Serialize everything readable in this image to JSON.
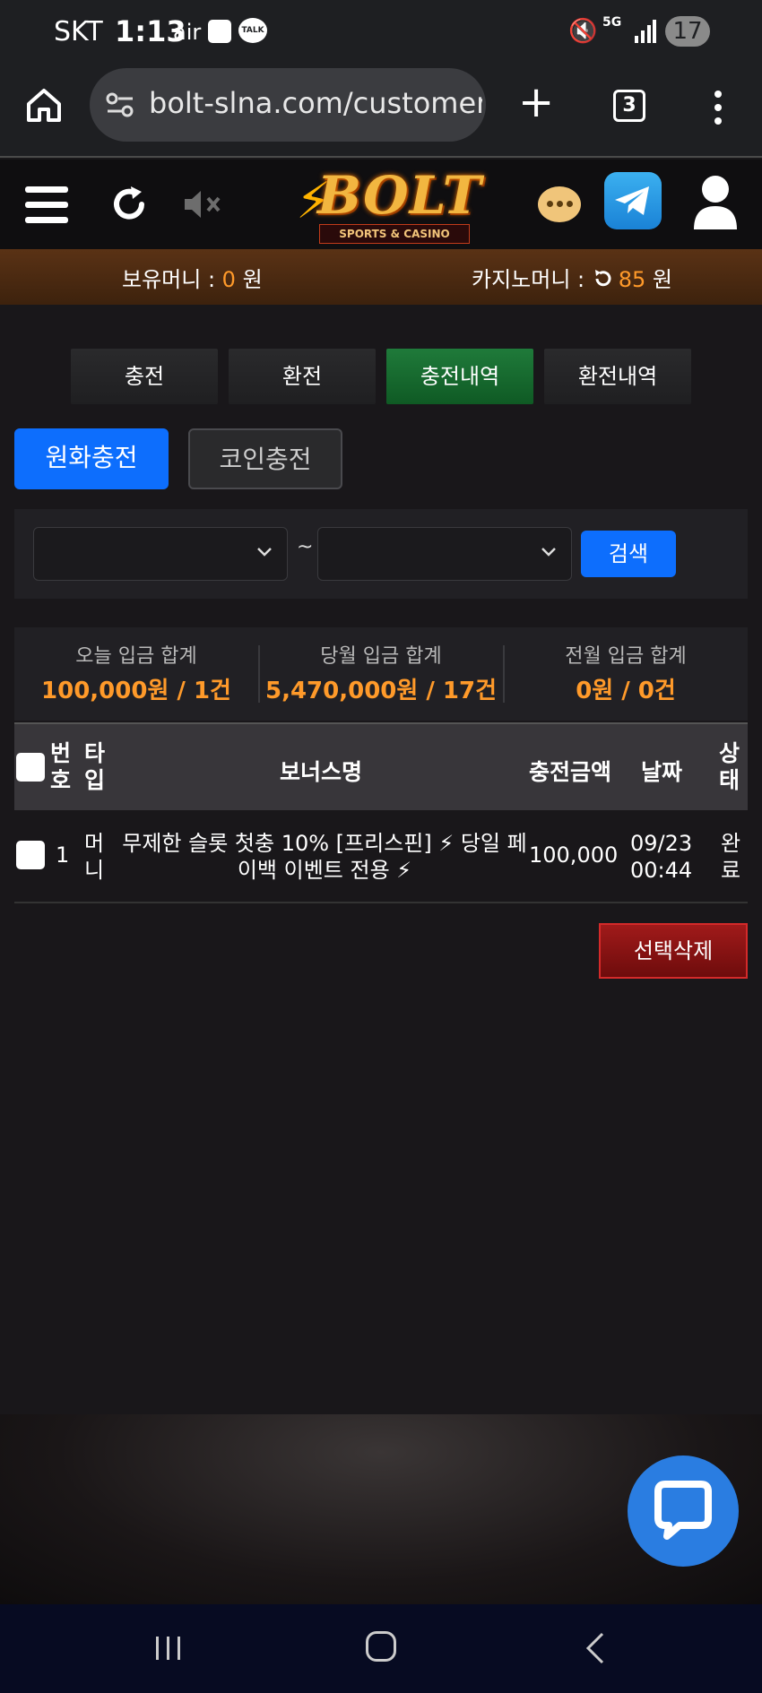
{
  "status_bar": {
    "carrier": "SKT",
    "time": "1:13",
    "air": "air",
    "talk": "TALK",
    "network": "5G",
    "battery": "17"
  },
  "browser": {
    "url": "bolt-slna.com/customer/",
    "tab_count": "3"
  },
  "header": {
    "logo_text": "BOLT",
    "logo_tagline": "SPORTS & CASINO"
  },
  "balance": {
    "money_label": "보유머니 : ",
    "money_value": "0",
    "money_unit": " 원",
    "casino_label": "카지노머니 : ",
    "casino_value": "85",
    "casino_unit": " 원"
  },
  "tabs": [
    {
      "label": "충전"
    },
    {
      "label": "환전"
    },
    {
      "label": "충전내역",
      "active": true
    },
    {
      "label": "환전내역"
    }
  ],
  "subtabs": [
    {
      "label": "원화충전",
      "active": true
    },
    {
      "label": "코인충전"
    }
  ],
  "filter": {
    "separator": "~",
    "search_label": "검색"
  },
  "summary": [
    {
      "label": "오늘 입금 합계",
      "value": "100,000원 / 1건"
    },
    {
      "label": "당월 입금 합계",
      "value": "5,470,000원 / 17건"
    },
    {
      "label": "전월 입금 합계",
      "value": "0원 / 0건"
    }
  ],
  "table": {
    "headers": {
      "no_1": "번",
      "no_2": "호",
      "type_1": "타",
      "type_2": "입",
      "bonus": "보너스명",
      "amount": "충전금액",
      "date": "날짜",
      "status_1": "상",
      "status_2": "태"
    },
    "rows": [
      {
        "no": "1",
        "type_1": "머",
        "type_2": "니",
        "bonus_line1": "무제한 슬롯 첫충 10% [프리스핀] ⚡ 당일 페",
        "bonus_line2": "이백 이벤트 전용 ⚡",
        "amount": "100,000",
        "date": "09/23",
        "time": "00:44",
        "status_1": "완",
        "status_2": "료"
      }
    ]
  },
  "delete_label": "선택삭제",
  "colors": {
    "accent_blue": "#0d6efd",
    "active_tab_green": "#1f7a3a",
    "highlight_orange": "#ff9a2a",
    "delete_red": "#a01a1a"
  }
}
